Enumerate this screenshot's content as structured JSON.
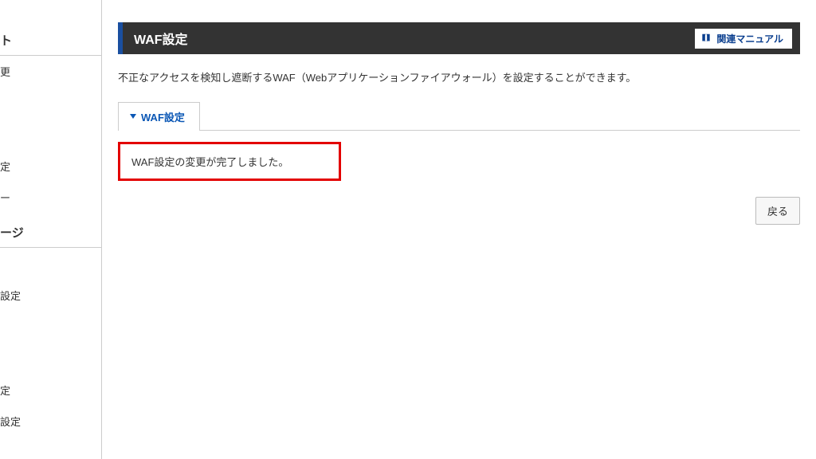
{
  "sidebar": {
    "group1": {
      "heading": "ト"
    },
    "items1": [
      "更"
    ],
    "items2": [
      "定",
      "ー"
    ],
    "group2": {
      "heading": "ージ"
    },
    "items3": [
      "設定"
    ],
    "items4": [
      "定",
      "設定"
    ]
  },
  "header": {
    "title": "WAF設定",
    "manual_label": "関連マニュアル"
  },
  "description": "不正なアクセスを検知し遮断するWAF（Webアプリケーションファイアウォール）を設定することができます。",
  "tabs": {
    "active": "WAF設定"
  },
  "message": "WAF設定の変更が完了しました。",
  "actions": {
    "back_label": "戻る"
  }
}
